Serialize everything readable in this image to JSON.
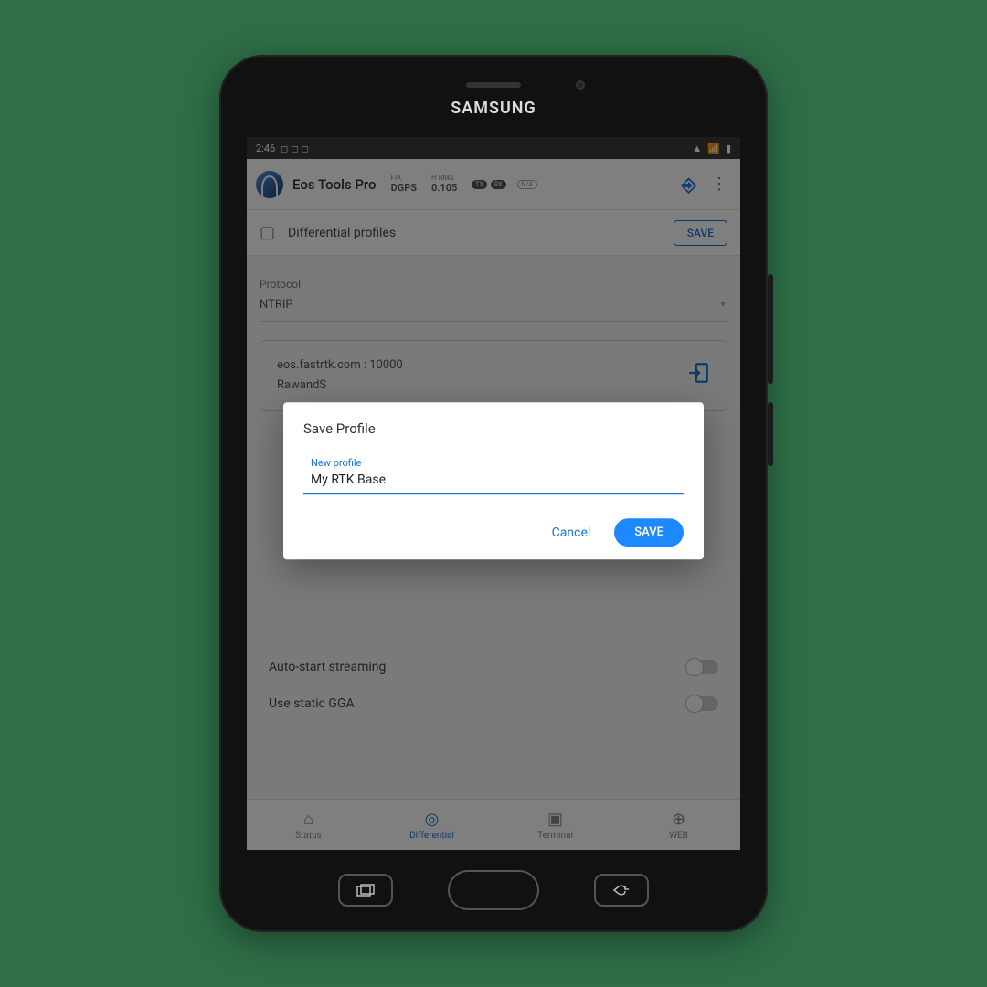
{
  "device": {
    "brand": "SAMSUNG"
  },
  "statusbar": {
    "time": "2:46",
    "left_icons": "⬚ ⬚ 📶",
    "wifi": "📶",
    "signal": "📶",
    "battery": "🔋"
  },
  "header": {
    "app_name": "Eos Tools Pro",
    "fix_label": "FIX",
    "fix_value": "DGPS",
    "hrms_label": "H RMS",
    "hrms_value": "0.105",
    "tx": "TX",
    "rx": "RX",
    "na": "N/A"
  },
  "section": {
    "title": "Differential profiles",
    "save": "SAVE"
  },
  "protocol": {
    "label": "Protocol",
    "value": "NTRIP"
  },
  "server": {
    "host_line": "eos.fastrtk.com : 10000",
    "mount": "RawandS"
  },
  "toggles": {
    "auto_start": "Auto-start streaming",
    "static_gga": "Use static GGA"
  },
  "nav": {
    "status": "Status",
    "differential": "Differential",
    "terminal": "Terminal",
    "web": "WEB"
  },
  "dialog": {
    "title": "Save Profile",
    "field_label": "New profile",
    "field_value": "My RTK Base",
    "cancel": "Cancel",
    "save": "SAVE"
  }
}
